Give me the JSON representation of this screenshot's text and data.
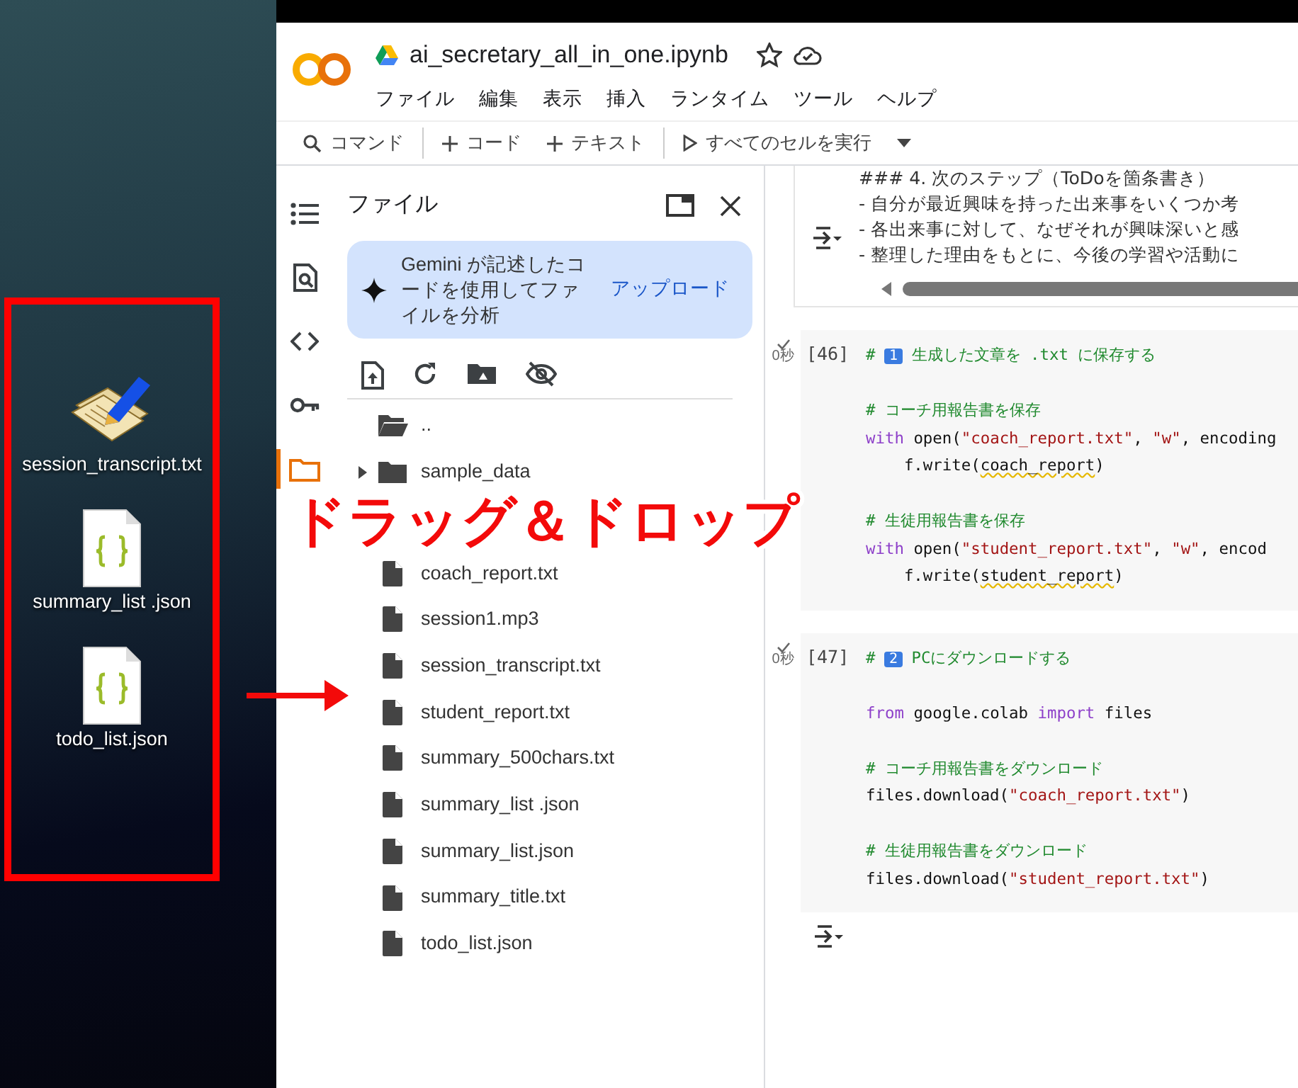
{
  "desktop": {
    "icons": [
      {
        "label": "session_transcript.txt",
        "kind": "text"
      },
      {
        "label": "summary_list .json",
        "kind": "json"
      },
      {
        "label": "todo_list.json",
        "kind": "json"
      }
    ]
  },
  "window": {
    "title": "ai_secretary_all_in_one.ipynb",
    "menu": [
      "ファイル",
      "編集",
      "表示",
      "挿入",
      "ランタイム",
      "ツール",
      "ヘルプ"
    ]
  },
  "toolbar": [
    {
      "label": "コマンド",
      "kind": "search"
    },
    {
      "label": "コード",
      "kind": "add"
    },
    {
      "label": "テキスト",
      "kind": "add"
    },
    {
      "label": "すべてのセルを実行",
      "kind": "run"
    }
  ],
  "rail": [
    {
      "kind": "toc",
      "selected": false
    },
    {
      "kind": "find",
      "selected": false
    },
    {
      "kind": "code",
      "selected": false
    },
    {
      "kind": "key",
      "selected": false
    },
    {
      "kind": "folder",
      "selected": true
    }
  ],
  "files_panel": {
    "title": "ファイル",
    "gemini": {
      "text": "Gemini が記述したコードを使用してファイルを分析",
      "action": "アップロード"
    },
    "tools": [
      {
        "kind": "upload"
      },
      {
        "kind": "refresh"
      },
      {
        "kind": "drive"
      },
      {
        "kind": "hide"
      }
    ],
    "items": [
      {
        "name": "..",
        "kind": "parent"
      },
      {
        "name": "sample_data",
        "kind": "folder",
        "expanded": false
      },
      {
        "name": "coach_report.txt",
        "kind": "file"
      },
      {
        "name": "session1.mp3",
        "kind": "file"
      },
      {
        "name": "session_transcript.txt",
        "kind": "file"
      },
      {
        "name": "student_report.txt",
        "kind": "file"
      },
      {
        "name": "summary_500chars.txt",
        "kind": "file"
      },
      {
        "name": "summary_list .json",
        "kind": "file"
      },
      {
        "name": "summary_list.json",
        "kind": "file"
      },
      {
        "name": "summary_title.txt",
        "kind": "file"
      },
      {
        "name": "todo_list.json",
        "kind": "file"
      }
    ]
  },
  "notebook": {
    "output": [
      "### 4. 次のステップ（ToDoを箇条書き）",
      "- 自分が最近興味を持った出来事をいくつか考",
      "- 各出来事に対して、なぜそれが興味深いと感",
      "- 整理した理由をもとに、今後の学習や活動に"
    ],
    "cells": [
      {
        "count": "[46]",
        "time": "0秒",
        "lines": [
          {
            "tokens": [
              {
                "t": "# ",
                "kind": "comment"
              },
              {
                "t": "1",
                "kind": "keycap"
              },
              {
                "t": " 生成した文章を .txt に保存する",
                "kind": "comment"
              }
            ]
          },
          {
            "gap_before": true,
            "tokens": [
              {
                "t": "# コーチ用報告書を保存",
                "kind": "comment"
              }
            ]
          },
          {
            "tokens": [
              {
                "t": "with",
                "kind": "keyword"
              },
              {
                "t": " open(",
                "kind": "plain"
              },
              {
                "t": "\"coach_report.txt\"",
                "kind": "string"
              },
              {
                "t": ", ",
                "kind": "plain"
              },
              {
                "t": "\"w\"",
                "kind": "string"
              },
              {
                "t": ", encoding",
                "kind": "plain"
              }
            ]
          },
          {
            "tokens": [
              {
                "t": "    f.write(",
                "kind": "plain"
              },
              {
                "t": "coach_report",
                "kind": "warn"
              },
              {
                "t": ")",
                "kind": "plain"
              }
            ]
          },
          {
            "gap_before": true,
            "tokens": [
              {
                "t": "# 生徒用報告書を保存",
                "kind": "comment"
              }
            ]
          },
          {
            "tokens": [
              {
                "t": "with",
                "kind": "keyword"
              },
              {
                "t": " open(",
                "kind": "plain"
              },
              {
                "t": "\"student_report.txt\"",
                "kind": "string"
              },
              {
                "t": ", ",
                "kind": "plain"
              },
              {
                "t": "\"w\"",
                "kind": "string"
              },
              {
                "t": ", encod",
                "kind": "plain"
              }
            ]
          },
          {
            "tokens": [
              {
                "t": "    f.write(",
                "kind": "plain"
              },
              {
                "t": "student_report",
                "kind": "warn"
              },
              {
                "t": ")",
                "kind": "plain"
              }
            ]
          }
        ]
      },
      {
        "count": "[47]",
        "time": "0秒",
        "lines": [
          {
            "tokens": [
              {
                "t": "# ",
                "kind": "comment"
              },
              {
                "t": "2",
                "kind": "keycap"
              },
              {
                "t": " PCにダウンロードする",
                "kind": "comment"
              }
            ]
          },
          {
            "gap_before": true,
            "tokens": [
              {
                "t": "from",
                "kind": "keyword"
              },
              {
                "t": " google.colab ",
                "kind": "plain"
              },
              {
                "t": "import",
                "kind": "keyword"
              },
              {
                "t": " files",
                "kind": "plain"
              }
            ]
          },
          {
            "gap_before": true,
            "tokens": [
              {
                "t": "# コーチ用報告書をダウンロード",
                "kind": "comment"
              }
            ]
          },
          {
            "tokens": [
              {
                "t": "files.download(",
                "kind": "plain"
              },
              {
                "t": "\"coach_report.txt\"",
                "kind": "string"
              },
              {
                "t": ")",
                "kind": "plain"
              }
            ]
          },
          {
            "gap_before": true,
            "tokens": [
              {
                "t": "# 生徒用報告書をダウンロード",
                "kind": "comment"
              }
            ]
          },
          {
            "tokens": [
              {
                "t": "files.download(",
                "kind": "plain"
              },
              {
                "t": "\"student_report.txt\"",
                "kind": "string"
              },
              {
                "t": ")",
                "kind": "plain"
              }
            ]
          }
        ]
      }
    ]
  },
  "annotation": {
    "label": "ドラッグ＆ドロップ"
  }
}
